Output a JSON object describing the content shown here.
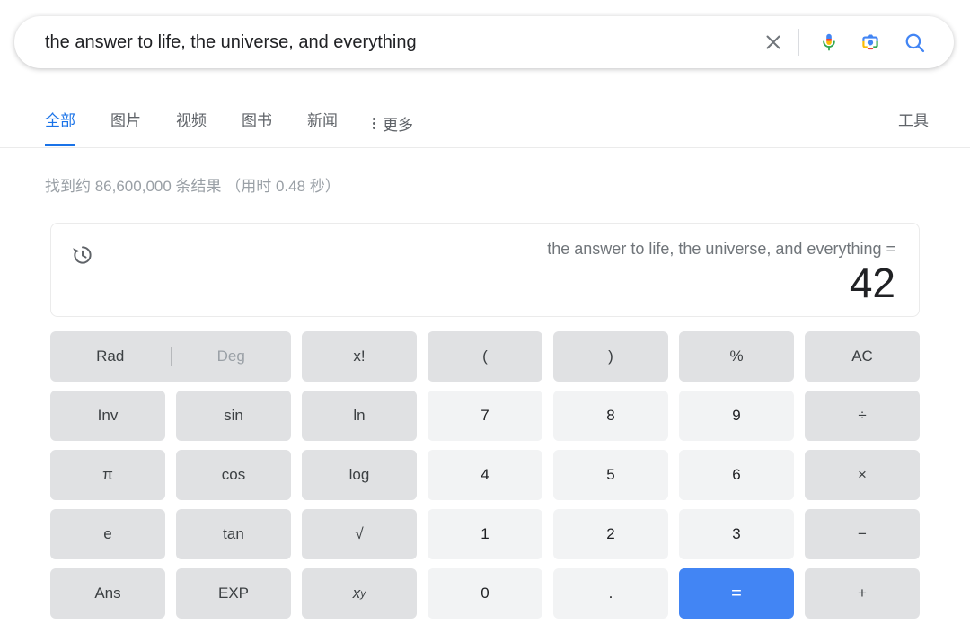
{
  "search": {
    "query": "the answer to life, the universe, and everything",
    "clear_icon": "close-icon",
    "mic_icon": "microphone-icon",
    "lens_icon": "google-lens-camera-icon",
    "search_icon": "search-icon"
  },
  "nav": {
    "items": [
      {
        "label": "全部",
        "active": true
      },
      {
        "label": "图片",
        "active": false
      },
      {
        "label": "视频",
        "active": false
      },
      {
        "label": "图书",
        "active": false
      },
      {
        "label": "新闻",
        "active": false
      }
    ],
    "more_label": "更多",
    "more_icon": "kebab-menu-icon",
    "tools_label": "工具"
  },
  "result_stats": "找到约 86,600,000 条结果 （用时 0.48 秒）",
  "calculator": {
    "history_icon": "history-restore-icon",
    "expression": "the answer to life, the universe, and everything =",
    "result": "42",
    "mode": {
      "rad_label": "Rad",
      "deg_label": "Deg",
      "selected": "Rad"
    },
    "keys": [
      {
        "label": "x!",
        "type": "func"
      },
      {
        "label": "(",
        "type": "func"
      },
      {
        "label": ")",
        "type": "func"
      },
      {
        "label": "%",
        "type": "func"
      },
      {
        "label": "AC",
        "type": "func"
      },
      {
        "label": "Inv",
        "type": "func"
      },
      {
        "label": "sin",
        "type": "func"
      },
      {
        "label": "ln",
        "type": "func"
      },
      {
        "label": "7",
        "type": "digit"
      },
      {
        "label": "8",
        "type": "digit"
      },
      {
        "label": "9",
        "type": "digit"
      },
      {
        "label": "÷",
        "type": "func"
      },
      {
        "label": "π",
        "type": "func"
      },
      {
        "label": "cos",
        "type": "func"
      },
      {
        "label": "log",
        "type": "func"
      },
      {
        "label": "4",
        "type": "digit"
      },
      {
        "label": "5",
        "type": "digit"
      },
      {
        "label": "6",
        "type": "digit"
      },
      {
        "label": "×",
        "type": "func"
      },
      {
        "label": "e",
        "type": "func"
      },
      {
        "label": "tan",
        "type": "func"
      },
      {
        "label": "√",
        "type": "func"
      },
      {
        "label": "1",
        "type": "digit"
      },
      {
        "label": "2",
        "type": "digit"
      },
      {
        "label": "3",
        "type": "digit"
      },
      {
        "label": "−",
        "type": "func"
      },
      {
        "label": "Ans",
        "type": "func"
      },
      {
        "label": "EXP",
        "type": "func"
      },
      {
        "label": "xy",
        "type": "func",
        "render": "power"
      },
      {
        "label": "0",
        "type": "digit"
      },
      {
        "label": ".",
        "type": "digit"
      },
      {
        "label": "=",
        "type": "equals"
      },
      {
        "label": "+",
        "type": "func"
      }
    ]
  },
  "colors": {
    "accent_blue": "#4285f4",
    "tab_blue": "#1a73e8",
    "key_func": "#e0e1e3",
    "key_digit": "#f2f3f4"
  }
}
